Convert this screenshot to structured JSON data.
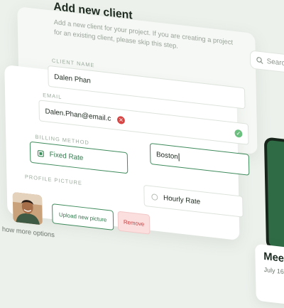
{
  "page": {
    "title": "Add new client",
    "subtitle": "Add a new client for your project. If you are creating a project for an existing client, please skip this step."
  },
  "search": {
    "placeholder": "Search"
  },
  "form": {
    "client_name": {
      "label": "CLIENT NAME",
      "value": "Dalen Phan"
    },
    "email": {
      "label": "EMAIL",
      "value": "Dalen.Phan@email.c"
    },
    "city": {
      "value": "Boston"
    },
    "billing": {
      "label": "BILLING METHOD",
      "options": [
        {
          "label": "Fixed Rate",
          "selected": true
        },
        {
          "label": "Hourly Rate",
          "selected": false
        }
      ]
    },
    "profile": {
      "label": "PROFILE PICTURE",
      "upload_label": "Upload new picture",
      "remove_label": "Remove"
    }
  },
  "more_options": "how more options",
  "side_card": {
    "title": "Mee",
    "date": "July 16"
  },
  "colors": {
    "accent": "#3d8a5a",
    "error": "#d84545",
    "success": "#6cc07f",
    "remove_bg": "#fbdede"
  },
  "icons": {
    "search": "search-icon",
    "check": "check-circle-icon",
    "error": "error-x-icon"
  }
}
